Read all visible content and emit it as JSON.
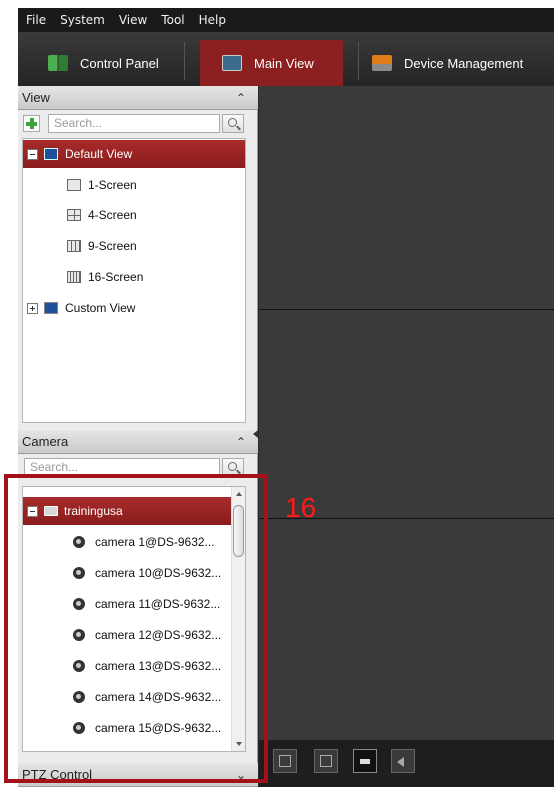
{
  "menu": [
    "File",
    "System",
    "View",
    "Tool",
    "Help"
  ],
  "tabs": {
    "control_panel": "Control Panel",
    "main_view": "Main View",
    "device_management": "Device Management"
  },
  "view_section": {
    "title": "View",
    "search_placeholder": "Search...",
    "default_view": "Default View",
    "screens": [
      "1-Screen",
      "4-Screen",
      "9-Screen",
      "16-Screen"
    ],
    "custom_view": "Custom View"
  },
  "camera_section": {
    "title": "Camera",
    "search_placeholder": "Search...",
    "group": "trainingusa",
    "cameras": [
      "camera 1@DS-9632...",
      "camera 10@DS-9632...",
      "camera 11@DS-9632...",
      "camera 12@DS-9632...",
      "camera 13@DS-9632...",
      "camera 14@DS-9632...",
      "camera 15@DS-9632..."
    ]
  },
  "ptz_section": {
    "title": "PTZ Control"
  },
  "annotation": {
    "label": "16",
    "color": "#ff1a1a"
  },
  "colors": {
    "accent": "#8c2020",
    "highlight": "#a31218"
  },
  "icons": {
    "control_panel": "control-panel-icon",
    "main_view": "main-view-icon",
    "device_management": "device-management-icon"
  }
}
